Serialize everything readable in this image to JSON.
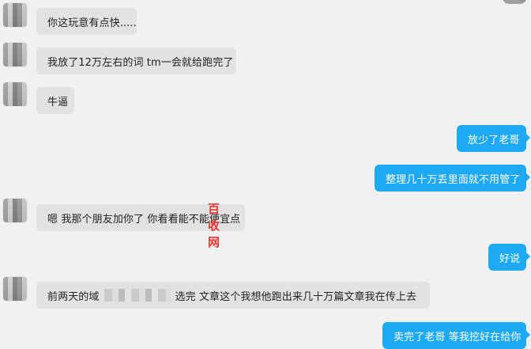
{
  "chat": {
    "messages": [
      {
        "side": "incoming",
        "text": "你这玩意有点快....."
      },
      {
        "side": "incoming",
        "text": "我放了12万左右的词 tm一会就给跑完了"
      },
      {
        "side": "incoming",
        "text": "牛逼"
      },
      {
        "side": "outgoing",
        "text": "放少了老哥"
      },
      {
        "side": "outgoing",
        "text": "整理几十万丢里面就不用管了"
      },
      {
        "side": "incoming",
        "text": "嗯 我那个朋友加你了 你看看能不能便宜点"
      },
      {
        "side": "outgoing",
        "text": "好说"
      },
      {
        "side": "incoming",
        "text_left": "前两天的域",
        "text_right": "选完 文章这个我想他跑出来几十万篇文章我在传上去"
      },
      {
        "side": "outgoing",
        "text": "卖完了老哥 等我挖好在给你"
      }
    ]
  },
  "watermark": {
    "text": "百收网"
  },
  "colors": {
    "background": "#f1f1f1",
    "incoming_bubble": "#e2e2e2",
    "outgoing_bubble": "#1ea9f3",
    "watermark": "#e53935"
  }
}
